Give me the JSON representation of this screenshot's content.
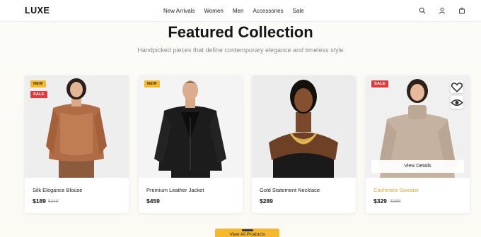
{
  "header": {
    "logo": "LUXE",
    "nav": [
      "New Arrivals",
      "Women",
      "Men",
      "Accessories",
      "Sale"
    ],
    "icons": [
      "search-icon",
      "user-icon",
      "bag-icon"
    ]
  },
  "hero": {
    "title": "Featured Collection",
    "subtitle": "Handpicked pieces that define contemporary elegance and timeless style"
  },
  "products": [
    {
      "name": "Silk Elegance Blouse",
      "price": "$189",
      "old_price": "$249",
      "badges": [
        "NEW",
        "SALE"
      ]
    },
    {
      "name": "Premium Leather Jacket",
      "price": "$459",
      "badges": [
        "NEW"
      ]
    },
    {
      "name": "Gold Statement Necklace",
      "price": "$289",
      "badges": []
    },
    {
      "name": "Cashmere Sweater",
      "price": "$329",
      "old_price": "$399",
      "badges": [
        "SALE"
      ],
      "hovered": true,
      "view_details": "View Details"
    }
  ],
  "cta": {
    "label": "View All Products"
  },
  "colors": {
    "accent": "#f5b82e",
    "sale": "#e0393e",
    "highlight_name": "#e3a63a"
  }
}
